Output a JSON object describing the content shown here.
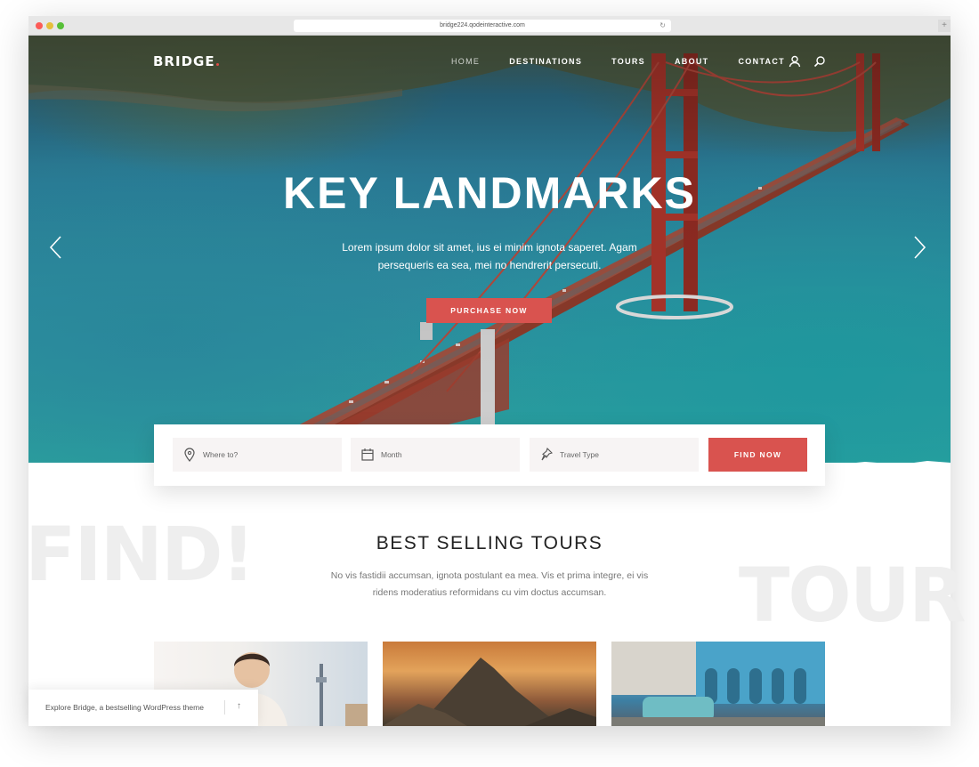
{
  "browser": {
    "url": "bridge224.qodeinteractive.com",
    "reload_icon": "reload-icon",
    "new_tab_label": "+"
  },
  "nav": {
    "logo": "BRIDGE",
    "items": [
      {
        "label": "HOME",
        "active": true
      },
      {
        "label": "DESTINATIONS",
        "active": false
      },
      {
        "label": "TOURS",
        "active": false
      },
      {
        "label": "ABOUT",
        "active": false
      },
      {
        "label": "CONTACT",
        "active": false
      }
    ],
    "icons": [
      "user-icon",
      "search-icon"
    ]
  },
  "hero": {
    "title": "KEY LANDMARKS",
    "subtitle_line1": "Lorem ipsum dolor sit amet, ius ei minim ignota saperet. Agam",
    "subtitle_line2": "persequeris ea sea, mei no hendrerit persecuti.",
    "button": "PURCHASE NOW",
    "prev_icon": "chevron-left-icon",
    "next_icon": "chevron-right-icon"
  },
  "search": {
    "where_placeholder": "Where to?",
    "month_placeholder": "Month",
    "type_placeholder": "Travel Type",
    "button": "FIND NOW"
  },
  "section": {
    "bg_word_left": "FIND!",
    "bg_word_right": "TOUR",
    "title": "BEST SELLING TOURS",
    "subtitle_line1": "No vis fastidii accumsan, ignota postulant ea mea. Vis et prima integre, ei vis",
    "subtitle_line2": "ridens moderatius reformidans cu vim doctus accumsan."
  },
  "promo": {
    "text": "Explore Bridge, a bestselling WordPress theme",
    "arrow": "↑"
  },
  "colors": {
    "accent": "#d9534f",
    "heading": "#222222",
    "muted": "#777777"
  }
}
